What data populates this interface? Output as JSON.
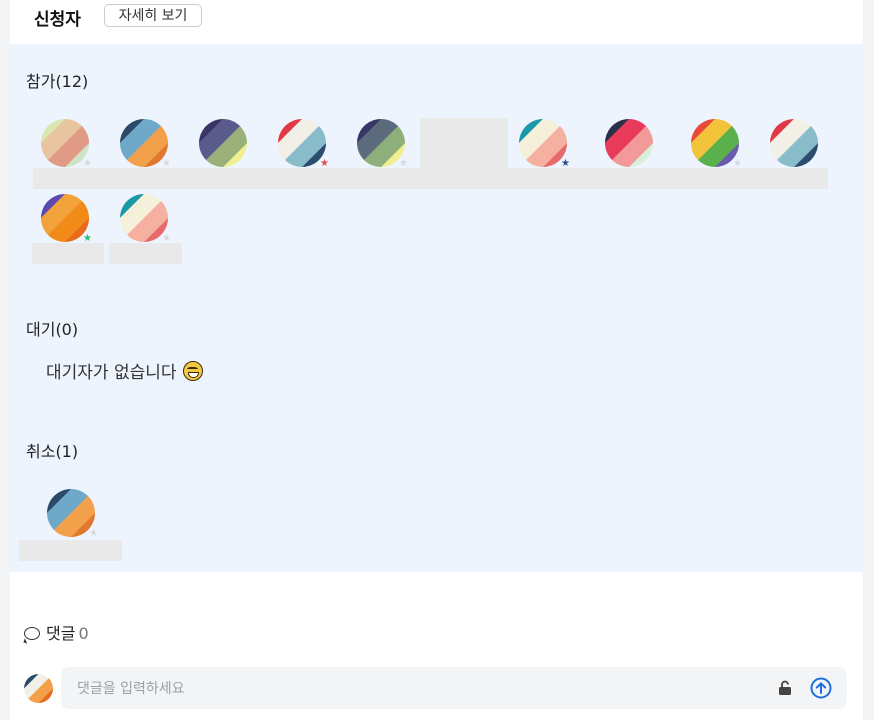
{
  "header": {
    "title": "신청자",
    "detail_button": "자세히 보기"
  },
  "participants": {
    "label": "참가(12)",
    "avatars": [
      {
        "colors": [
          "#d8e8b0",
          "#e9c4a0",
          "#e09a86",
          "#cfe3c5"
        ],
        "star_color": "#d9d9d9"
      },
      {
        "colors": [
          "#2b4a6a",
          "#6fa8c9",
          "#f2a04a",
          "#e0782e"
        ],
        "star_color": "#d9d9d9"
      },
      {
        "colors": [
          "#3a3566",
          "#5b5a8c",
          "#9ab07a",
          "#f0f090"
        ],
        "star_color": null
      },
      {
        "colors": [
          "#e03a46",
          "#f2f0e6",
          "#88bccb",
          "#2c4d6e"
        ],
        "star_color": "#e04a4a"
      },
      {
        "colors": [
          "#3a3566",
          "#5b6a7c",
          "#8fb07a",
          "#f0f090"
        ],
        "star_color": "#d9d9d9"
      },
      {
        "colors": [
          "#1a99a8",
          "#f4f0da",
          "#f6b0a0",
          "#e86a6a"
        ],
        "star_color": "#2a4d8f"
      },
      {
        "colors": [
          "#2b2f48",
          "#e83a5a",
          "#f29a9a",
          "#d8f0d8"
        ],
        "star_color": null
      },
      {
        "colors": [
          "#e84a3a",
          "#f2c23a",
          "#5ab04a",
          "#6a5ab0"
        ],
        "star_color": "#d9d9d9"
      },
      {
        "colors": [
          "#e03a46",
          "#f2f0e6",
          "#88bccb",
          "#2c4d6e"
        ],
        "star_color": null
      },
      {
        "colors": [
          "#5a4ab0",
          "#f2a23a",
          "#f28a1a",
          "#e86a1a"
        ],
        "star_color": "#2bbf7a"
      },
      {
        "colors": [
          "#1a99a8",
          "#f4f0da",
          "#f6b0a0",
          "#e86a6a"
        ],
        "star_color": "#d9d9d9"
      }
    ]
  },
  "waiting": {
    "label": "대기(0)",
    "empty_message": "대기자가 없습니다"
  },
  "cancelled": {
    "label": "취소(1)",
    "avatars": [
      {
        "colors": [
          "#2b4a6a",
          "#6fa8c9",
          "#f2a04a",
          "#e0782e"
        ],
        "star_color": "#d9d9d9"
      }
    ]
  },
  "comments": {
    "label": "댓글",
    "count": "0",
    "input_placeholder": "댓글을 입력하세요",
    "my_avatar_colors": [
      "#2b4a6a",
      "#f2f0e6",
      "#f2a04a",
      "#e86a1a"
    ]
  },
  "icons": {
    "comment": "speech-bubble-icon",
    "lock": "unlock-icon",
    "send": "arrow-up-circle-icon",
    "emoji": "grinning-sweat-emoji"
  },
  "colors": {
    "accent": "#1e6fe0",
    "panel_bg": "#eef4fd"
  }
}
